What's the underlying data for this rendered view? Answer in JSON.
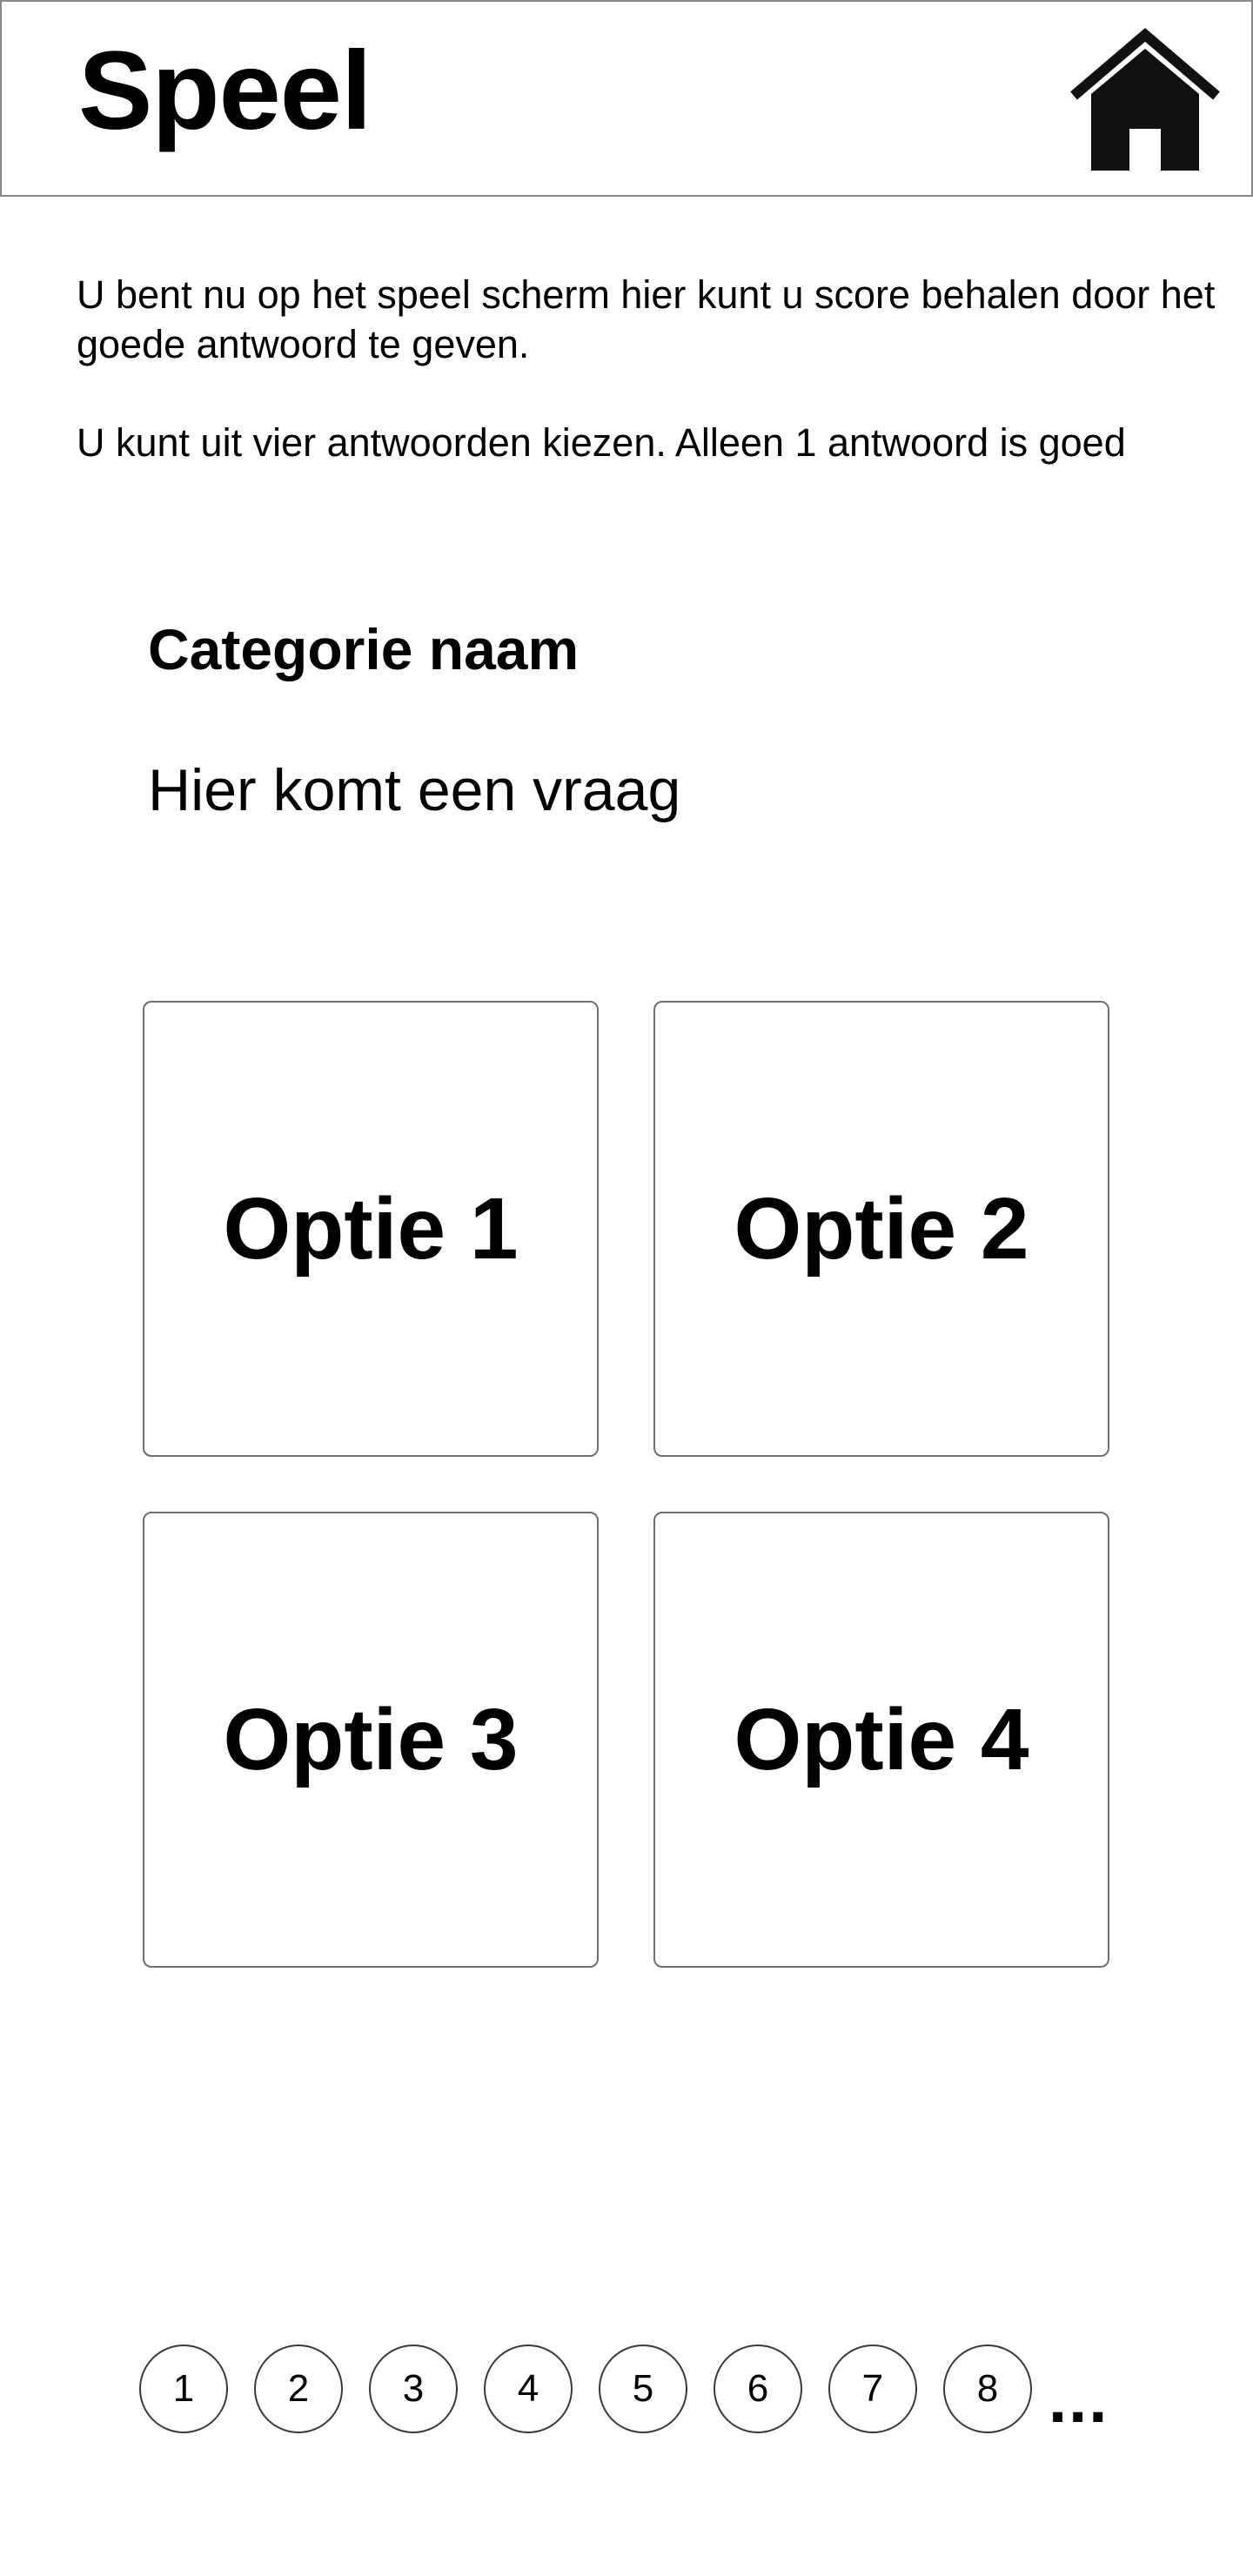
{
  "header": {
    "title": "Speel",
    "home_icon": "home-icon"
  },
  "intro": {
    "paragraph_1": "U bent nu op het speel scherm hier kunt u score behalen door het goede antwoord te geven.",
    "paragraph_2": "U kunt uit vier antwoorden kiezen. Alleen 1 antwoord is goed"
  },
  "quiz": {
    "category": "Categorie naam",
    "question": "Hier komt een vraag",
    "options": [
      {
        "label": "Optie 1"
      },
      {
        "label": "Optie 2"
      },
      {
        "label": "Optie 3"
      },
      {
        "label": "Optie 4"
      }
    ]
  },
  "pager": {
    "pages": [
      "1",
      "2",
      "3",
      "4",
      "5",
      "6",
      "7",
      "8"
    ],
    "more": "..."
  },
  "colors": {
    "background": "#ffffff",
    "text": "#000000",
    "border": "#8a8a8a",
    "icon": "#111111"
  }
}
